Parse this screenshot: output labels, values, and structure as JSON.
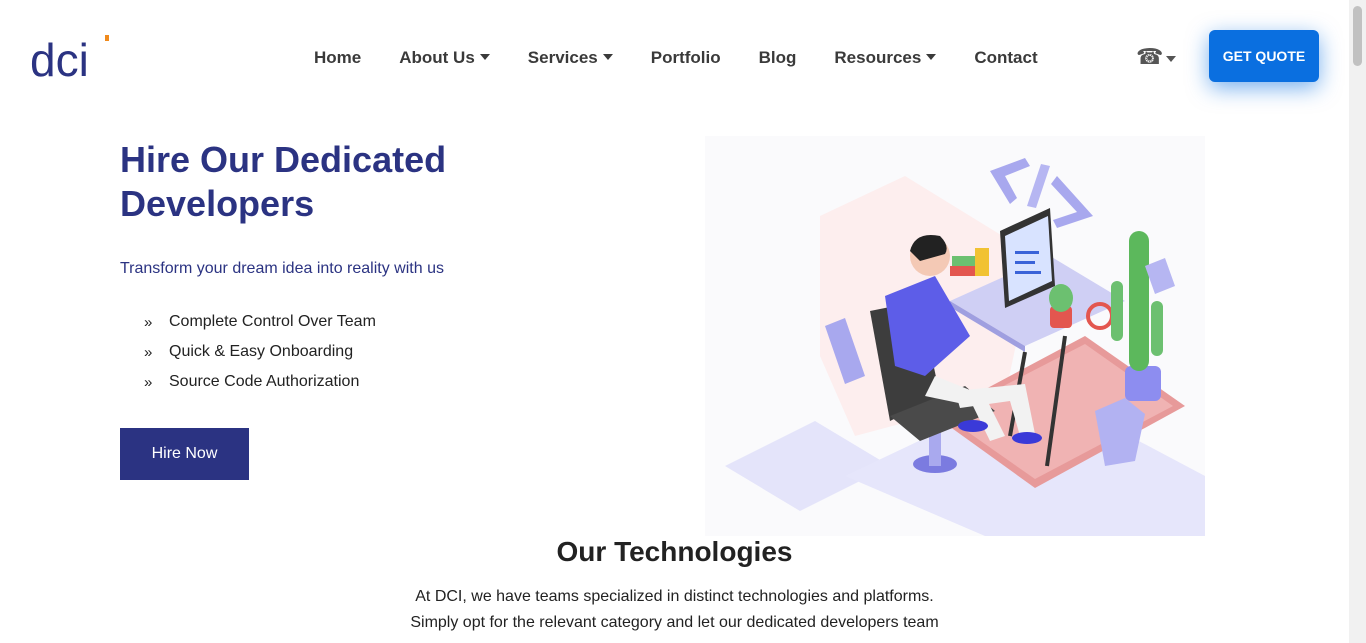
{
  "header": {
    "logo_text": "dci",
    "nav": [
      {
        "label": "Home",
        "has_dropdown": false
      },
      {
        "label": "About Us",
        "has_dropdown": true
      },
      {
        "label": "Services",
        "has_dropdown": true
      },
      {
        "label": "Portfolio",
        "has_dropdown": false
      },
      {
        "label": "Blog",
        "has_dropdown": false
      },
      {
        "label": "Resources",
        "has_dropdown": true
      },
      {
        "label": "Contact",
        "has_dropdown": false
      }
    ],
    "phone_icon": "phone-icon",
    "cta_label": "GET QUOTE"
  },
  "hero": {
    "title": "Hire Our Dedicated Developers",
    "subtitle": "Transform your dream idea into reality with us",
    "features": [
      "Complete Control Over Team",
      "Quick & Easy Onboarding",
      "Source Code Authorization"
    ],
    "feature_icon": "double-chevron-right-icon",
    "cta_label": "Hire Now",
    "illustration": "developer-at-desk-illustration"
  },
  "technologies": {
    "title": "Our Technologies",
    "description_lines": [
      "At DCI, we have teams specialized in distinct technologies and platforms.",
      "Simply opt for the relevant category and let our dedicated developers team"
    ]
  },
  "colors": {
    "brand_navy": "#2b3382",
    "cta_blue": "#0a6fe0",
    "logo_accent": "#f08a1c"
  }
}
